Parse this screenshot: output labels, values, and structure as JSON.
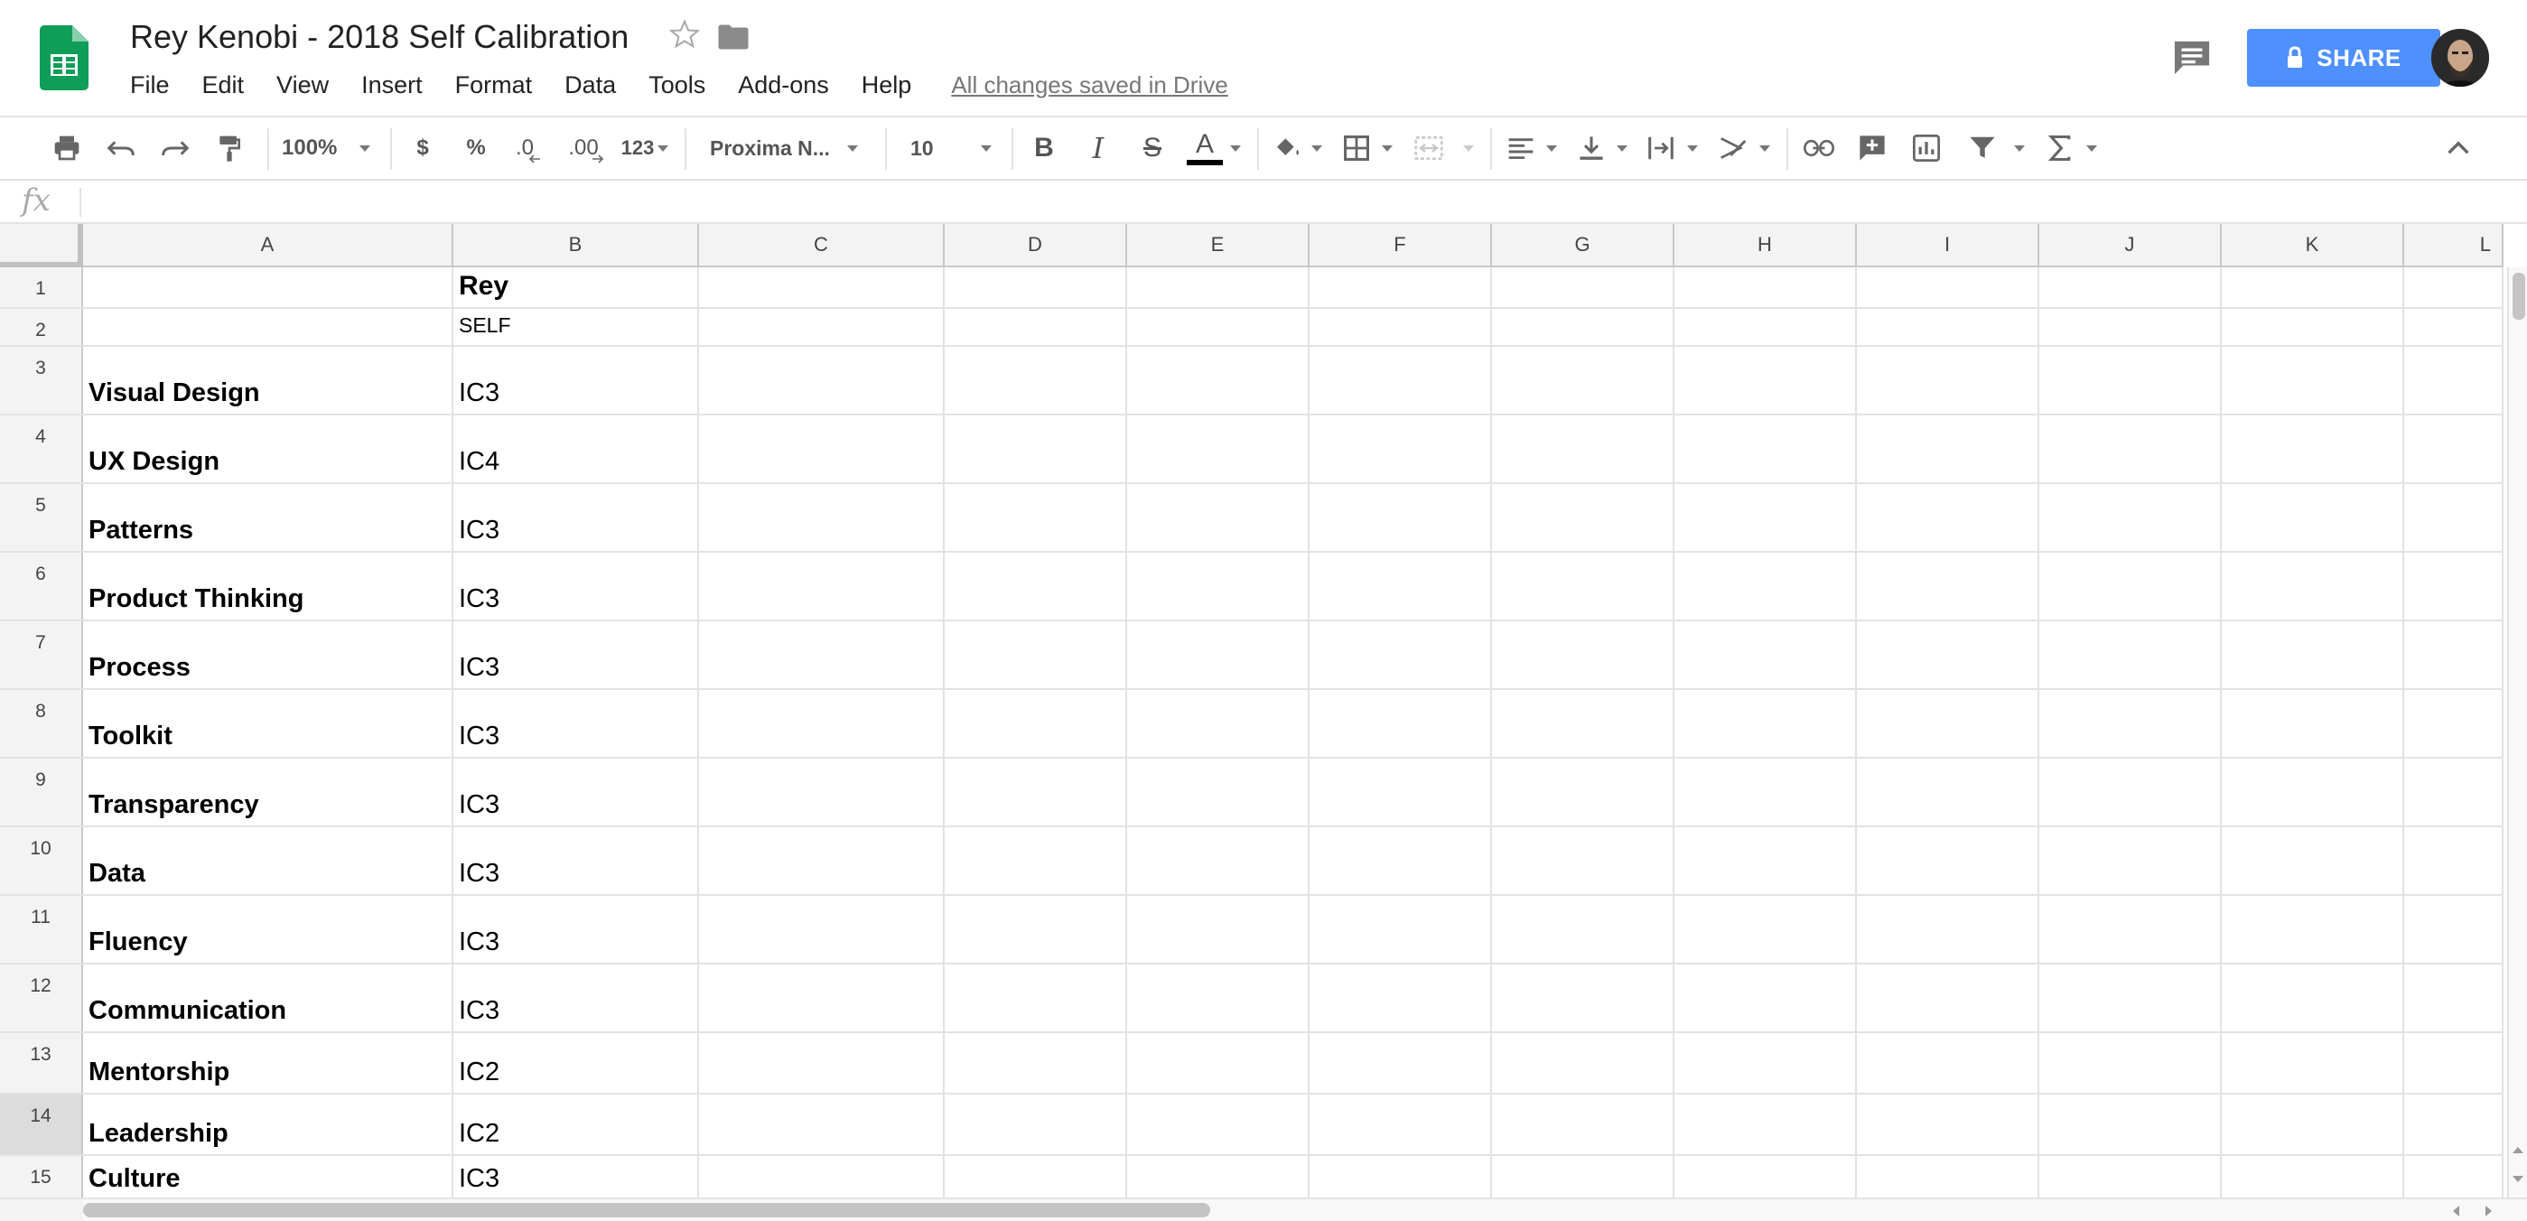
{
  "document": {
    "title": "Rey Kenobi - 2018 Self Calibration",
    "save_status": "All changes saved in Drive"
  },
  "menu": [
    "File",
    "Edit",
    "View",
    "Insert",
    "Format",
    "Data",
    "Tools",
    "Add-ons",
    "Help"
  ],
  "header": {
    "share_label": "SHARE"
  },
  "toolbar": {
    "zoom": "100%",
    "currency": "$",
    "percent": "%",
    "decrease_decimal": ".0",
    "increase_decimal": ".00",
    "more_formats": "123",
    "font_family": "Proxima N...",
    "font_size": "10",
    "bold": "B",
    "italic": "I",
    "strikethrough": "S",
    "text_color_glyph": "A"
  },
  "formula_bar": {
    "label": "fx",
    "value": ""
  },
  "grid": {
    "columns": [
      "A",
      "B",
      "C",
      "D",
      "E",
      "F",
      "G",
      "H",
      "I",
      "J",
      "K",
      "L"
    ],
    "selected_row": "14",
    "rows": [
      {
        "num": "1",
        "a": "",
        "b": "Rey"
      },
      {
        "num": "2",
        "a": "",
        "b": "SELF"
      },
      {
        "num": "3",
        "a": "Visual Design",
        "b": "IC3"
      },
      {
        "num": "4",
        "a": "UX Design",
        "b": "IC4"
      },
      {
        "num": "5",
        "a": "Patterns",
        "b": "IC3"
      },
      {
        "num": "6",
        "a": "Product Thinking",
        "b": "IC3"
      },
      {
        "num": "7",
        "a": "Process",
        "b": "IC3"
      },
      {
        "num": "8",
        "a": "Toolkit",
        "b": "IC3"
      },
      {
        "num": "9",
        "a": "Transparency",
        "b": "IC3"
      },
      {
        "num": "10",
        "a": "Data",
        "b": "IC3"
      },
      {
        "num": "11",
        "a": "Fluency",
        "b": "IC3"
      },
      {
        "num": "12",
        "a": "Communication",
        "b": "IC3"
      },
      {
        "num": "13",
        "a": "Mentorship",
        "b": "IC2"
      },
      {
        "num": "14",
        "a": "Leadership",
        "b": "IC2"
      },
      {
        "num": "15",
        "a": "Culture",
        "b": "IC3"
      }
    ]
  },
  "colors": {
    "share_blue": "#4d90fe",
    "sheets_green": "#0f9d58"
  }
}
